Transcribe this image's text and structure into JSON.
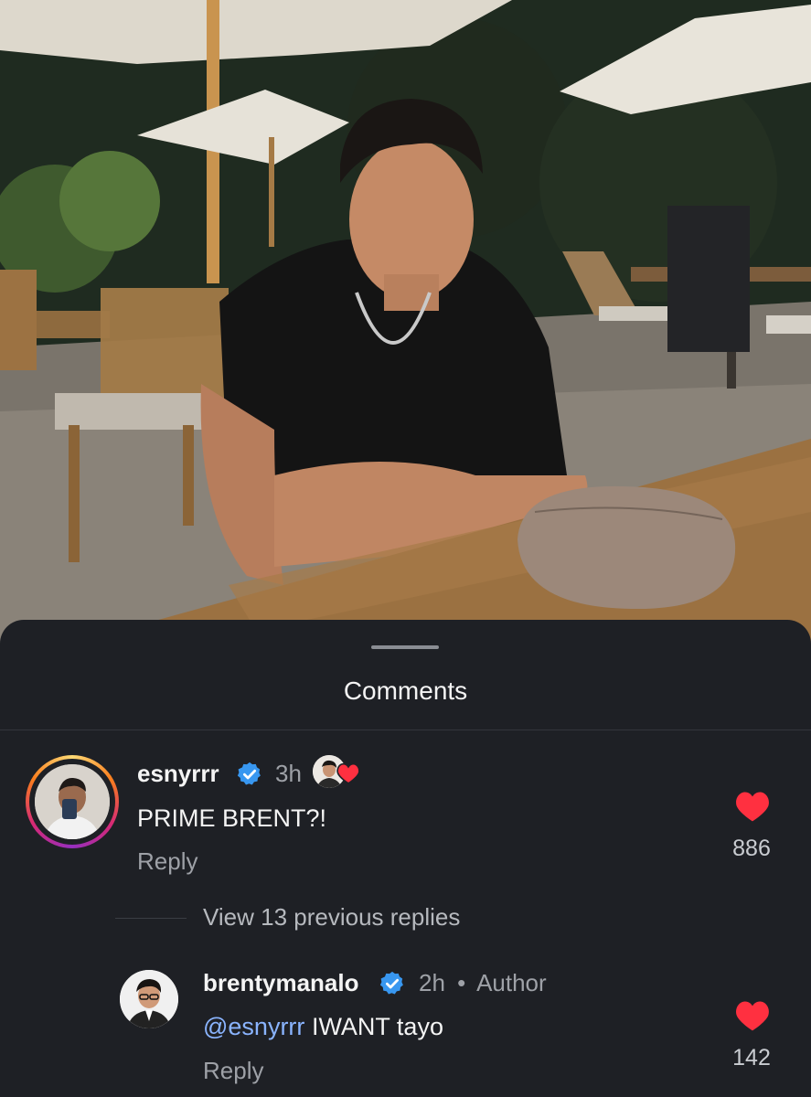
{
  "sheet": {
    "title": "Comments"
  },
  "comments": [
    {
      "username": "esnyrrr",
      "time": "3h",
      "text": "PRIME BRENT?!",
      "reply_label": "Reply",
      "likes": "886",
      "liked_by_author": true
    },
    {
      "username": "brentymanalo",
      "time": "2h",
      "separator": "•",
      "author_tag": "Author",
      "mention": "@esnyrrr",
      "text": "IWANT tayo",
      "reply_label": "Reply",
      "likes": "142"
    }
  ],
  "thread": {
    "view_replies_label": "View 13 previous replies"
  },
  "colors": {
    "sheet_bg": "#1e2025",
    "like_red": "#ff3040",
    "verified_blue": "#3897f0",
    "mention_blue": "#8ab4ff",
    "muted_text": "#9ea1a7"
  },
  "icons": [
    "verified-badge-icon",
    "heart-icon",
    "drag-handle-icon"
  ]
}
